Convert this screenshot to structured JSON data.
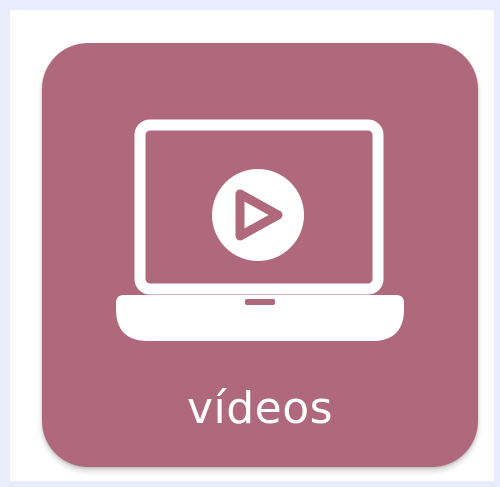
{
  "tile": {
    "label": "vídeos",
    "icon": "laptop-play-icon",
    "color": "#b0687c",
    "foreground": "#ffffff"
  },
  "page": {
    "background": "#e9ecfd",
    "canvas": "#ffffff"
  }
}
